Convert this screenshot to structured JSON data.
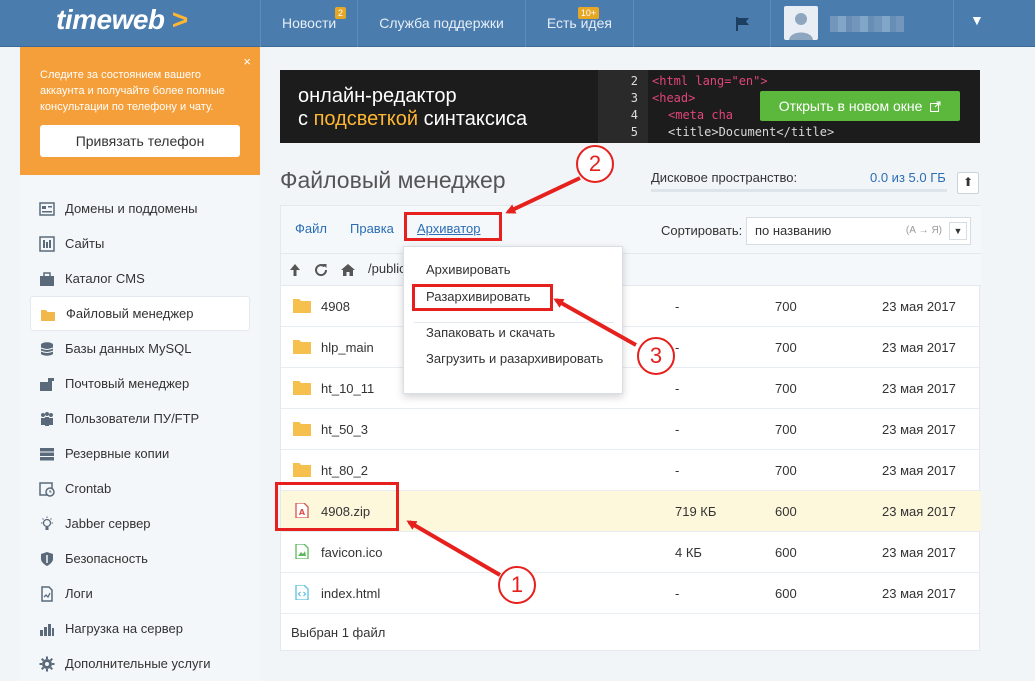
{
  "header": {
    "logo": "timeweb",
    "logo_arrow": ">",
    "nav": [
      {
        "label": "Новости",
        "badge": "2"
      },
      {
        "label": "Служба поддержки",
        "badge": ""
      },
      {
        "label": "Есть идея",
        "badge": "10+"
      }
    ],
    "icons": [
      "flag-icon",
      "user-avatar-icon",
      "chevron-down-icon"
    ]
  },
  "promo": {
    "text": "Следите за состоянием вашего аккаунта и получайте более полные консультации по телефону и чату.",
    "close": "×",
    "button": "Привязать телефон"
  },
  "sidebar": {
    "items": [
      {
        "label": "Домены и поддомены",
        "icon": "domains-icon",
        "active": false
      },
      {
        "label": "Сайты",
        "icon": "sites-icon",
        "active": false
      },
      {
        "label": "Каталог CMS",
        "icon": "cms-icon",
        "active": false
      },
      {
        "label": "Файловый менеджер",
        "icon": "folder-icon",
        "active": true
      },
      {
        "label": "Базы данных MySQL",
        "icon": "database-icon",
        "active": false
      },
      {
        "label": "Почтовый менеджер",
        "icon": "mail-icon",
        "active": false
      },
      {
        "label": "Пользователи ПУ/FTP",
        "icon": "users-icon",
        "active": false
      },
      {
        "label": "Резервные копии",
        "icon": "backup-icon",
        "active": false
      },
      {
        "label": "Crontab",
        "icon": "clock-icon",
        "active": false
      },
      {
        "label": "Jabber сервер",
        "icon": "bulb-icon",
        "active": false
      },
      {
        "label": "Безопасность",
        "icon": "shield-icon",
        "active": false
      },
      {
        "label": "Логи",
        "icon": "logs-icon",
        "active": false
      },
      {
        "label": "Нагрузка на сервер",
        "icon": "chart-icon",
        "active": false
      },
      {
        "label": "Дополнительные услуги",
        "icon": "gear-icon",
        "active": false
      }
    ]
  },
  "banner": {
    "line1": "онлайн-редактор",
    "line2_pre": "с ",
    "line2_hl": "подсветкой",
    "line2_post": " синтаксиса",
    "code": [
      {
        "n": "2",
        "text": "<html lang=\"en\">"
      },
      {
        "n": "3",
        "text": "<head>"
      },
      {
        "n": "4",
        "text": "<meta cha"
      },
      {
        "n": "5",
        "text": "<title>Document</title>"
      }
    ],
    "button": "Открыть в новом окне"
  },
  "page": {
    "title": "Файловый менеджер",
    "disk_label": "Дисковое пространство:",
    "disk_value": "0.0 из 5.0 ГБ",
    "disk_used_fraction": 0.0
  },
  "toolbar": {
    "file": "Файл",
    "edit": "Правка",
    "archiver": "Архиватор",
    "sort_label": "Сортировать:",
    "sort_value": "по названию",
    "sort_dir": "(А → Я)"
  },
  "pathbar": {
    "path": "/public"
  },
  "files": [
    {
      "name": "4908",
      "type": "folder",
      "size": "-",
      "perm": "700",
      "date": "23 мая 2017",
      "selected": false
    },
    {
      "name": "hlp_main",
      "type": "folder",
      "size": "-",
      "perm": "700",
      "date": "23 мая 2017",
      "selected": false
    },
    {
      "name": "ht_10_11",
      "type": "folder",
      "size": "-",
      "perm": "700",
      "date": "23 мая 2017",
      "selected": false
    },
    {
      "name": "ht_50_3",
      "type": "folder",
      "size": "-",
      "perm": "700",
      "date": "23 мая 2017",
      "selected": false
    },
    {
      "name": "ht_80_2",
      "type": "folder",
      "size": "-",
      "perm": "700",
      "date": "23 мая 2017",
      "selected": false
    },
    {
      "name": "4908.zip",
      "type": "zip",
      "size": "719 КБ",
      "perm": "600",
      "date": "23 мая 2017",
      "selected": true
    },
    {
      "name": "favicon.ico",
      "type": "image",
      "size": "4 КБ",
      "perm": "600",
      "date": "23 мая 2017",
      "selected": false
    },
    {
      "name": "index.html",
      "type": "html",
      "size": "-",
      "perm": "600",
      "date": "23 мая 2017",
      "selected": false
    }
  ],
  "footer": "Выбран 1 файл",
  "dropdown": {
    "items": [
      "Архивировать",
      "Разархивировать",
      "Запаковать и скачать",
      "Загрузить и разархивировать"
    ]
  },
  "annotations": [
    "1",
    "2",
    "3"
  ],
  "colors": {
    "topbar": "#4a7cad",
    "accent": "#2a6db5",
    "promo": "#f59f3a",
    "button_green": "#5cb83c",
    "annotation_red": "#e5201d",
    "selected_row": "#fdf7dc"
  }
}
